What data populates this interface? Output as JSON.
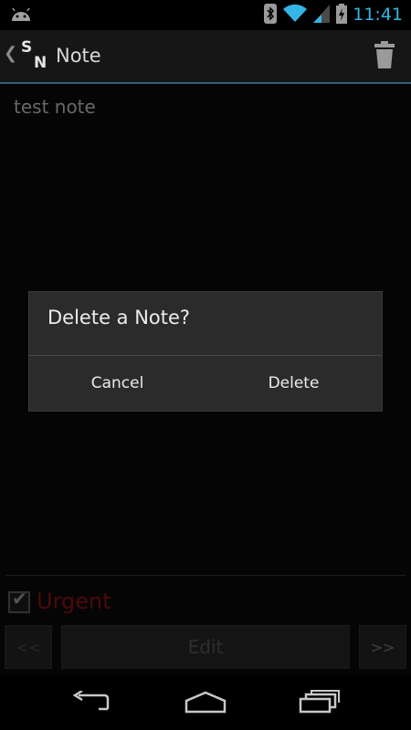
{
  "status_bar": {
    "time": "11:41",
    "icons": [
      "android-icon",
      "bluetooth-icon",
      "wifi-icon",
      "signal-icon",
      "battery-icon"
    ]
  },
  "action_bar": {
    "logo_letters": [
      "S",
      "N"
    ],
    "title": "Note",
    "actions": [
      "trash-icon"
    ]
  },
  "note": {
    "text": "test note",
    "urgent_label": "Urgent",
    "urgent_checked": true,
    "buttons": {
      "prev": "<<",
      "edit": "Edit",
      "next": ">>"
    }
  },
  "dialog": {
    "title": "Delete a Note?",
    "cancel_label": "Cancel",
    "delete_label": "Delete"
  },
  "colors": {
    "accent": "#33b5e5",
    "urgent": "#8b1111",
    "dialog_bg": "#2b2b2b"
  },
  "nav_bar": {
    "keys": [
      "back-icon",
      "home-icon",
      "recents-icon"
    ]
  }
}
